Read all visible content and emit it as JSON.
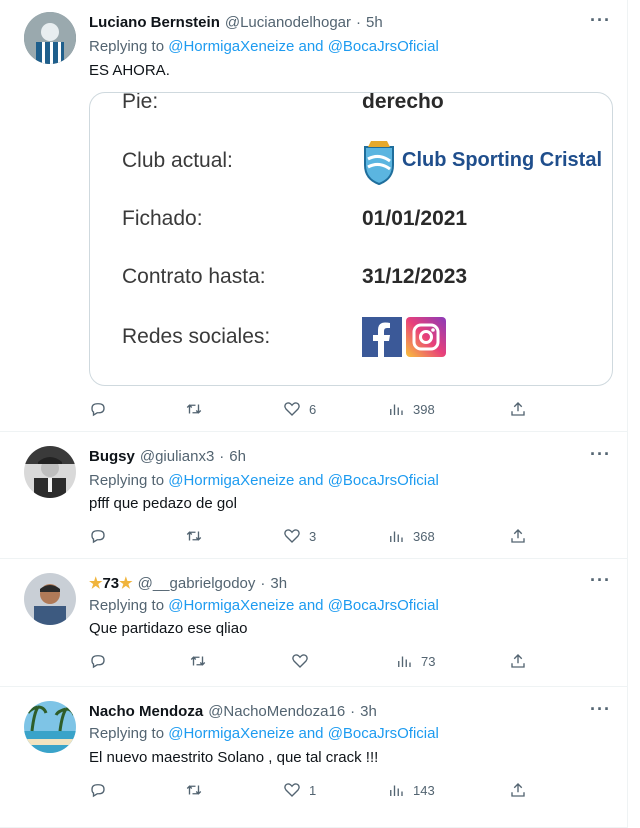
{
  "tweets": [
    {
      "name": "Luciano Bernstein",
      "handle": "@Lucianodelhogar",
      "time": "5h",
      "reply_prefix": "Replying to",
      "reply_to": "@HormigaXeneize and @BocaJrsOficial",
      "text": "ES AHORA.",
      "likes": "6",
      "views": "398"
    },
    {
      "name": "Bugsy",
      "handle": "@giulianx3",
      "time": "6h",
      "reply_prefix": "Replying to",
      "reply_to": "@HormigaXeneize and @BocaJrsOficial",
      "text": "pfff que pedazo de gol",
      "likes": "3",
      "views": "368"
    },
    {
      "name": "73",
      "handle": "@__gabrielgodoy",
      "time": "3h",
      "reply_prefix": "Replying to",
      "reply_to": "@HormigaXeneize and @BocaJrsOficial",
      "text": "Que partidazo ese qliao",
      "likes": "",
      "views": "73"
    },
    {
      "name": "Nacho Mendoza",
      "handle": "@NachoMendoza16",
      "time": "3h",
      "reply_prefix": "Replying to",
      "reply_to": "@HormigaXeneize and @BocaJrsOficial",
      "text": "El nuevo maestrito Solano , que tal crack !!!",
      "likes": "1",
      "views": "143"
    }
  ],
  "card": {
    "rows": [
      {
        "label": "Pie:",
        "value": "derecho"
      },
      {
        "label": "Club actual:",
        "value": "Club Sporting Cristal"
      },
      {
        "label": "Fichado:",
        "value": "01/01/2021"
      },
      {
        "label": "Contrato hasta:",
        "value": "31/12/2023"
      },
      {
        "label": "Redes sociales:",
        "value": ""
      }
    ]
  },
  "colors": {
    "link": "#1d9bf0",
    "muted": "#536471",
    "facebook": "#3b5998",
    "club": "#1f4e8c"
  },
  "icons": [
    "more-icon",
    "reply-icon",
    "retweet-icon",
    "like-icon",
    "views-icon",
    "share-icon",
    "star-icon",
    "facebook-icon",
    "instagram-icon",
    "club-crest-icon"
  ]
}
